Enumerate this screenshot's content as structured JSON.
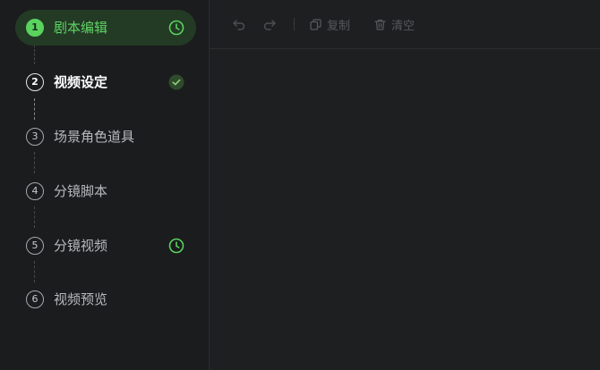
{
  "steps": [
    {
      "num": "1",
      "label": "剧本编辑",
      "state": "active",
      "status_icon": "clock-icon"
    },
    {
      "num": "2",
      "label": "视频设定",
      "state": "done",
      "status_icon": "check-circle-icon"
    },
    {
      "num": "3",
      "label": "场景角色道具",
      "state": "pending"
    },
    {
      "num": "4",
      "label": "分镜脚本",
      "state": "pending"
    },
    {
      "num": "5",
      "label": "分镜视频",
      "state": "pending",
      "status_icon": "clock-icon"
    },
    {
      "num": "6",
      "label": "视频预览",
      "state": "pending"
    }
  ],
  "toolbar": {
    "undo_icon": "undo-icon",
    "redo_icon": "redo-icon",
    "copy_label": "复制",
    "clear_label": "清空"
  },
  "colors": {
    "accent_green": "#59d35e",
    "active_bg": "#233a25",
    "background": "#1e1f21"
  }
}
